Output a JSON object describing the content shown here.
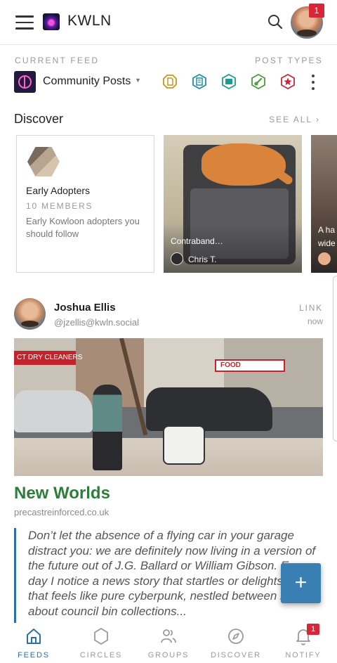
{
  "header": {
    "app_title": "KWLN",
    "menu_icon": "hamburger-menu-icon",
    "search_icon": "search-icon",
    "notification_count": "1"
  },
  "feed": {
    "current_feed_label": "CURRENT FEED",
    "current_feed_name": "Community Posts",
    "post_types_label": "POST TYPES",
    "post_types": [
      {
        "icon": "article-icon",
        "color": "#c9951b"
      },
      {
        "icon": "document-icon",
        "color": "#1f8fa6"
      },
      {
        "icon": "media-icon",
        "color": "#1c9c8c"
      },
      {
        "icon": "link-icon",
        "color": "#4e9a3a"
      },
      {
        "icon": "star-icon",
        "color": "#c8283a"
      }
    ]
  },
  "discover": {
    "title": "Discover",
    "see_all": "SEE ALL",
    "group_card": {
      "name": "Early Adopters",
      "members": "10 MEMBERS",
      "description": "Early Kowloon adopters you should follow"
    },
    "post_card": {
      "caption": "Contraband…",
      "author": "Chris T."
    },
    "partial_card": {
      "caption_line1": "A ha",
      "caption_line2": "wide"
    }
  },
  "post": {
    "author": "Joshua Ellis",
    "handle": "@jzellis@kwln.social",
    "type": "LINK",
    "time": "now",
    "image_signs": {
      "left": "CT DRY CLEANERS",
      "right": "FOOD"
    },
    "title": "New Worlds",
    "domain": "precastreinforced.co.uk",
    "excerpt": "Don’t let the absence of a flying car in your garage distract you: we are definitely now living in a version of the future out of J.G. Ballard or William Gibson. Every day I notice a news story that startles or delights me, that feels like pure cyberpunk, nestled between reports about council bin collections..."
  },
  "fab": {
    "label": "+"
  },
  "colors": {
    "accent": "#2c6fa8",
    "post_title": "#2e7d3b",
    "badge": "#d72638"
  },
  "nav": {
    "items": [
      {
        "label": "FEEDS",
        "icon": "home-icon"
      },
      {
        "label": "CIRCLES",
        "icon": "hexagon-icon"
      },
      {
        "label": "GROUPS",
        "icon": "users-icon"
      },
      {
        "label": "DISCOVER",
        "icon": "compass-icon"
      },
      {
        "label": "NOTIFY",
        "icon": "bell-icon",
        "badge": "1"
      }
    ]
  }
}
